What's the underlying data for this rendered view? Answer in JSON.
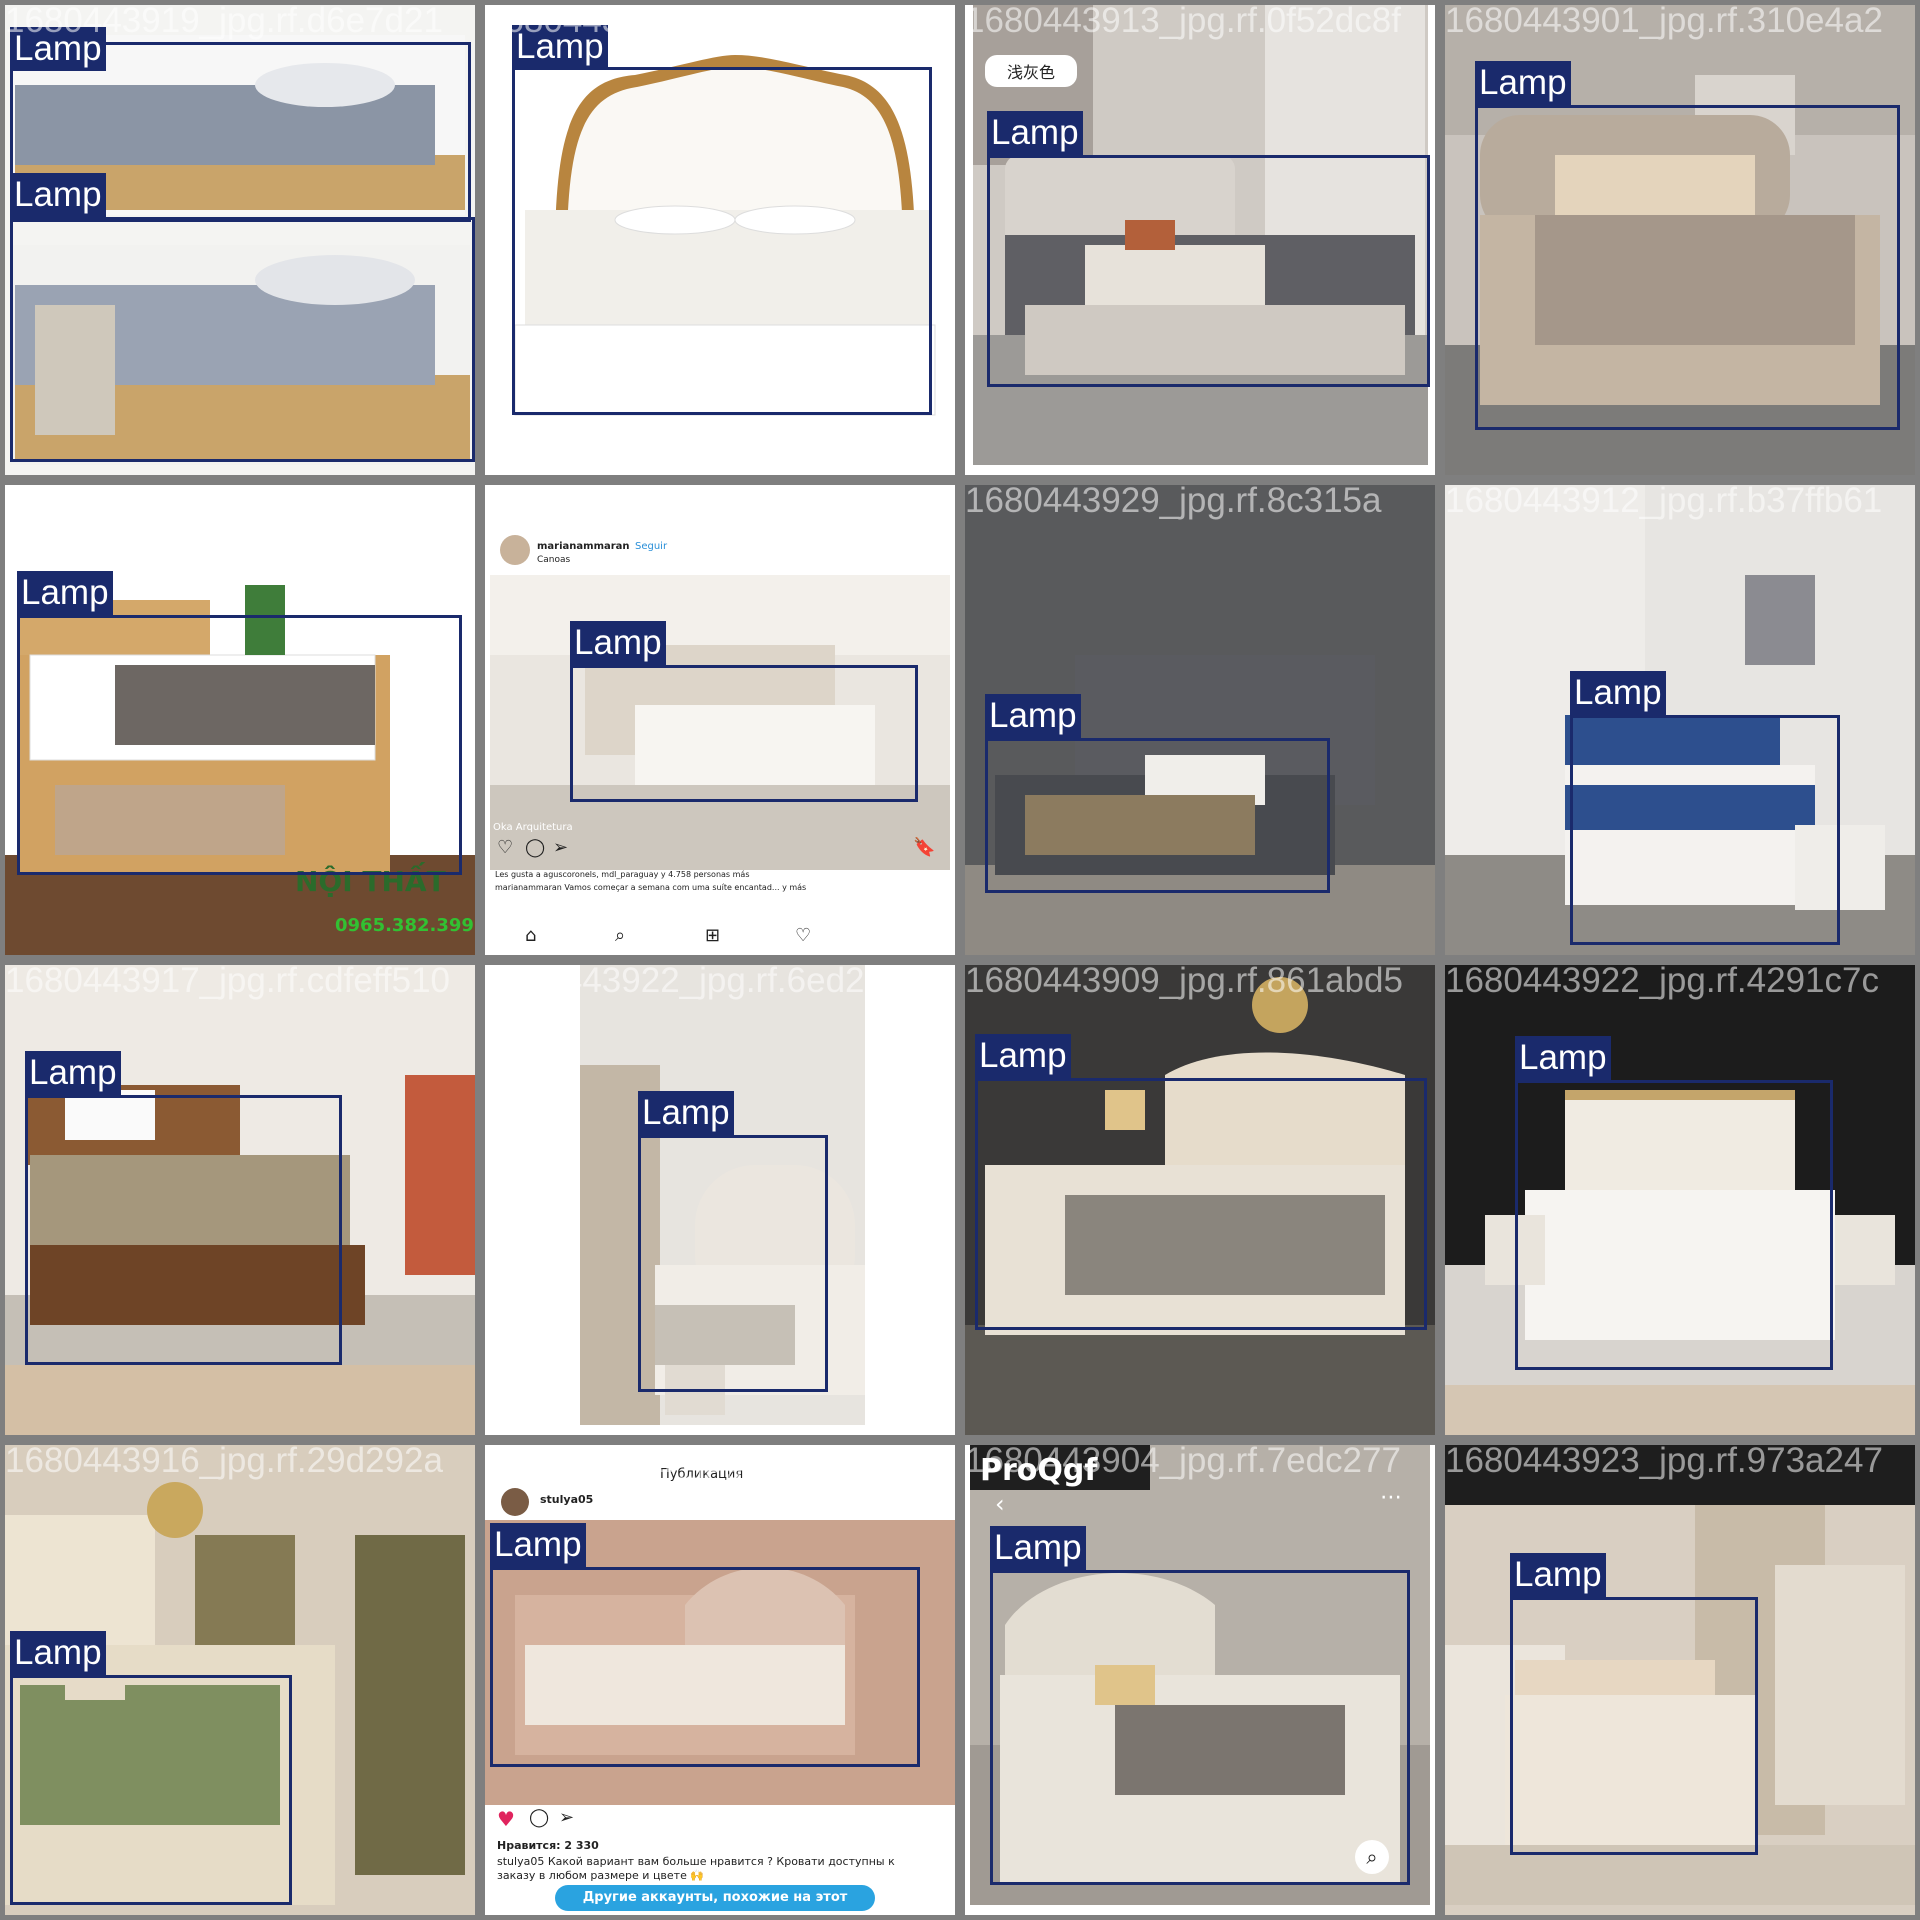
{
  "label_color": "#1a2a6c",
  "tiles": [
    {
      "filename": "1680443919_jpg.rf.d6e7d21",
      "labels": [
        "Lamp",
        "Lamp"
      ]
    },
    {
      "filename": "1680443919_jpg.rf.85ec19bd",
      "labels": [
        "Lamp"
      ]
    },
    {
      "filename": "1680443913_jpg.rf.0f52dc8f",
      "labels": [
        "Lamp"
      ],
      "badge": "浅灰色"
    },
    {
      "filename": "1680443901_jpg.rf.310e4a2",
      "labels": [
        "Lamp"
      ]
    },
    {
      "filename": "1680443918_jpg.rf.2d64d0a",
      "labels": [
        "Lamp"
      ],
      "shop_name": "NỘI THẤT",
      "shop_phone": "0965.382.399"
    },
    {
      "filename": "1680443920_jpg.rf.270f4",
      "labels": [
        "Lamp"
      ],
      "ig_user": "marianammaran",
      "ig_follow": "Seguir",
      "ig_location": "Canoas",
      "ig_photo_credit": "Oka Arquitetura",
      "ig_likes": "Les gusta a aguscoronels, mdl_paraguay y 4.758 personas más",
      "ig_caption": "marianammaran Vamos começar a semana com uma suíte encantad... y más"
    },
    {
      "filename": "1680443929_jpg.rf.8c315a",
      "labels": [
        "Lamp"
      ]
    },
    {
      "filename": "1680443912_jpg.rf.b37ffb61",
      "labels": [
        "Lamp"
      ]
    },
    {
      "filename": "1680443917_jpg.rf.cdfeff510",
      "labels": [
        "Lamp"
      ]
    },
    {
      "filename": "1680443922_jpg.rf.6ed23dfd",
      "labels": [
        "Lamp"
      ]
    },
    {
      "filename": "1680443909_jpg.rf.861abd5",
      "labels": [
        "Lamp"
      ]
    },
    {
      "filename": "1680443922_jpg.rf.4291c7c",
      "labels": [
        "Lamp"
      ]
    },
    {
      "filename": "1680443916_jpg.rf.29d292a",
      "labels": [
        "Lamp"
      ]
    },
    {
      "filename": "1680443911_jpg.rf.19a90",
      "labels": [
        "Lamp"
      ],
      "ig_header": "Публикация",
      "ig_user": "stulya05",
      "ig_likes": "Нравится: 2 330",
      "ig_caption": "stulya05 Какой вариант вам больше нравится ? Кровати доступны к заказу в любом размере и цвете 🙌",
      "ig_more": "Другие аккаунты, похожие на этот"
    },
    {
      "filename": "1680443904_jpg.rf.7edc277",
      "labels": [
        "Lamp"
      ],
      "brand": "ProQgf"
    },
    {
      "filename": "1680443923_jpg.rf.973a247",
      "labels": [
        "Lamp"
      ]
    }
  ]
}
